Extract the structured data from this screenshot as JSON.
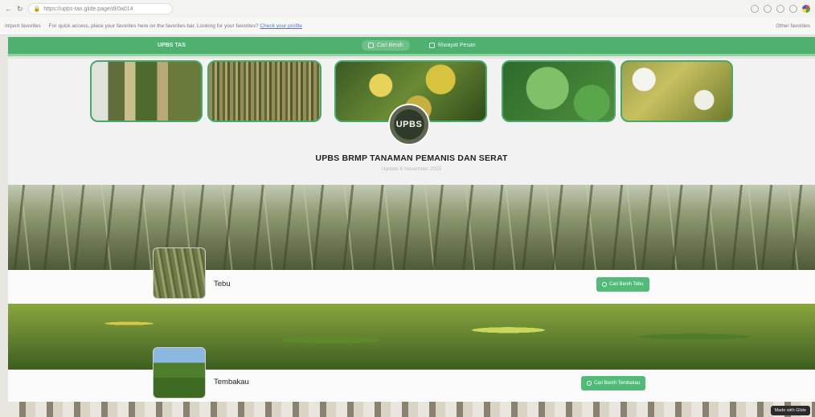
{
  "browser": {
    "url": "https://upbs-tan.glide.page/dl/0a014",
    "back_icon": "back-arrow-icon",
    "fav_bar": {
      "import_label": "Import favorites",
      "tip_text": "For quick access, place your favorites here on the favorites bar. Looking for your favorites?",
      "link_text": "Check your profile",
      "other_label": "Other favorites"
    }
  },
  "nav": {
    "brand": "UPBS TAS",
    "items": [
      {
        "label": "Cari Benih",
        "icon": "seed-icon"
      },
      {
        "label": "Riwayat Pesan",
        "icon": "history-icon"
      }
    ]
  },
  "hero": {
    "logo_text": "UPBS",
    "title": "UPBS BRMP TANAMAN PEMANIS DAN SERAT",
    "subtitle": "Update 6 November 2025"
  },
  "rows": [
    {
      "label": "Tebu",
      "button": "Cari Benih Tebu"
    },
    {
      "label": "Tembakau",
      "button": "Cari Benih Tembakau"
    }
  ],
  "footer": {
    "badge": "Made with Glide"
  },
  "colors": {
    "accent": "#4fb16e",
    "button": "#52bb78"
  }
}
